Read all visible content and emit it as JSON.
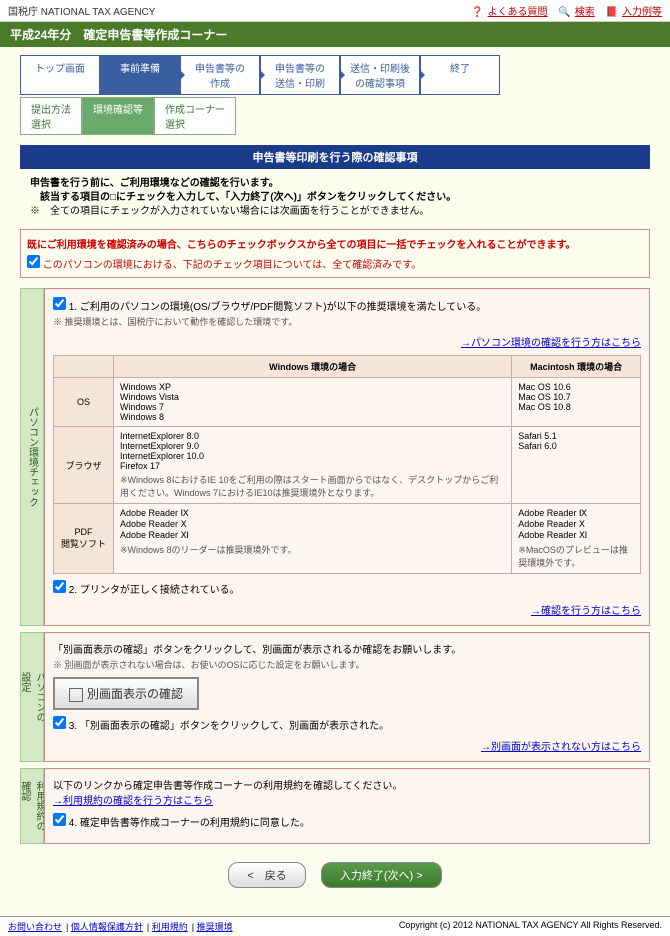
{
  "topbar": {
    "agency": "国税庁 NATIONAL TAX AGENCY",
    "faq": "よくある質問",
    "search": "検索",
    "help": "入力例等"
  },
  "title": "平成24年分　確定申告書等作成コーナー",
  "tabs1": [
    "トップ画面",
    "事前準備",
    "申告書等の\n作成",
    "申告書等の\n送信・印刷",
    "送信・印刷後\nの確認事項",
    "終了"
  ],
  "tabs2": [
    "提出方法\n選択",
    "環境確認等",
    "作成コーナー\n選択"
  ],
  "bluebar": "申告書等印刷を行う際の確認事項",
  "intro": {
    "l1": "申告書を行う前に、ご利用環境などの確認を行います。",
    "l2": "　該当する項目の□にチェックを入力して、「入力終了(次へ)」ボタンをクリックしてください。",
    "l3": "※　全ての項目にチェックが入力されていない場合には次画面を行うことができません。"
  },
  "redbox": {
    "title": "既にご利用環境を確認済みの場合、こちらのチェックボックスから全ての項目に一括でチェックを入れることができます。",
    "check": "このパソコンの環境における、下記のチェック項目については、全て確認済みです。"
  },
  "sec1": {
    "label": "パソコン環境チェック",
    "q1": "1. ご利用のパソコンの環境(OS/ブラウザ/PDF閲覧ソフト)が以下の推奨環境を満たしている。",
    "q1note": "※ 推奨環境とは、国税庁において動作を確認した環境です。",
    "link1": "→パソコン環境の確認を行う方はこちら",
    "th_win": "Windows 環境の場合",
    "th_mac": "Macintosh 環境の場合",
    "os_h": "OS",
    "os_win": "Windows XP\nWindows Vista\nWindows 7\nWindows 8",
    "os_mac": "Mac OS 10.6\nMac OS 10.7\nMac OS 10.8",
    "br_h": "ブラウザ",
    "br_win": "InternetExplorer 8.0\nInternetExplorer 9.0\nInternetExplorer 10.0\nFirefox 17",
    "br_win_note": "※Windows 8におけるIE 10をご利用の際はスタート画面からではなく、デスクトップからご利用ください。Windows 7におけるIE10は推奨環境外となります。",
    "br_mac": "Safari 5.1\nSafari 6.0",
    "pdf_h": "PDF\n閲覧ソフト",
    "pdf_win": "Adobe Reader Ⅸ\nAdobe Reader Ⅹ\nAdobe Reader Ⅺ",
    "pdf_win_note": "※Windows 8のリーダーは推奨環境外です。",
    "pdf_mac": "Adobe Reader Ⅸ\nAdobe Reader Ⅹ\nAdobe Reader Ⅺ",
    "pdf_mac_note": "※MacOSのプレビューは推奨環境外です。",
    "q2": "2. プリンタが正しく接続されている。",
    "link2": "→確認を行う方はこちら"
  },
  "sec2": {
    "label": "パソコンの\n設定",
    "desc1": "「別画面表示の確認」ボタンをクリックして、別画面が表示されるか確認をお願いします。",
    "desc2": "※ 別画面が表示されない場合は、お使いのOSに応じた設定をお願いします。",
    "btn": "別画面表示の確認",
    "q3": "3. 「別画面表示の確認」ボタンをクリックして、別画面が表示された。",
    "link": "→別画面が表示されない方はこちら"
  },
  "sec3": {
    "label": "利用規約の\n確認",
    "desc": "以下のリンクから確定申告書等作成コーナーの利用規約を確認してください。",
    "link": "→利用規約の確認を行う方はこちら",
    "q4": "4. 確定申告書等作成コーナーの利用規約に同意した。"
  },
  "buttons": {
    "back": "<　戻る",
    "next": "入力終了(次へ) >"
  },
  "footer": {
    "links": [
      "お問い合わせ",
      "個人情報保護方針",
      "利用規約",
      "推奨環境"
    ],
    "copy": "Copyright (c) 2012 NATIONAL TAX AGENCY All Rights Reserved."
  }
}
